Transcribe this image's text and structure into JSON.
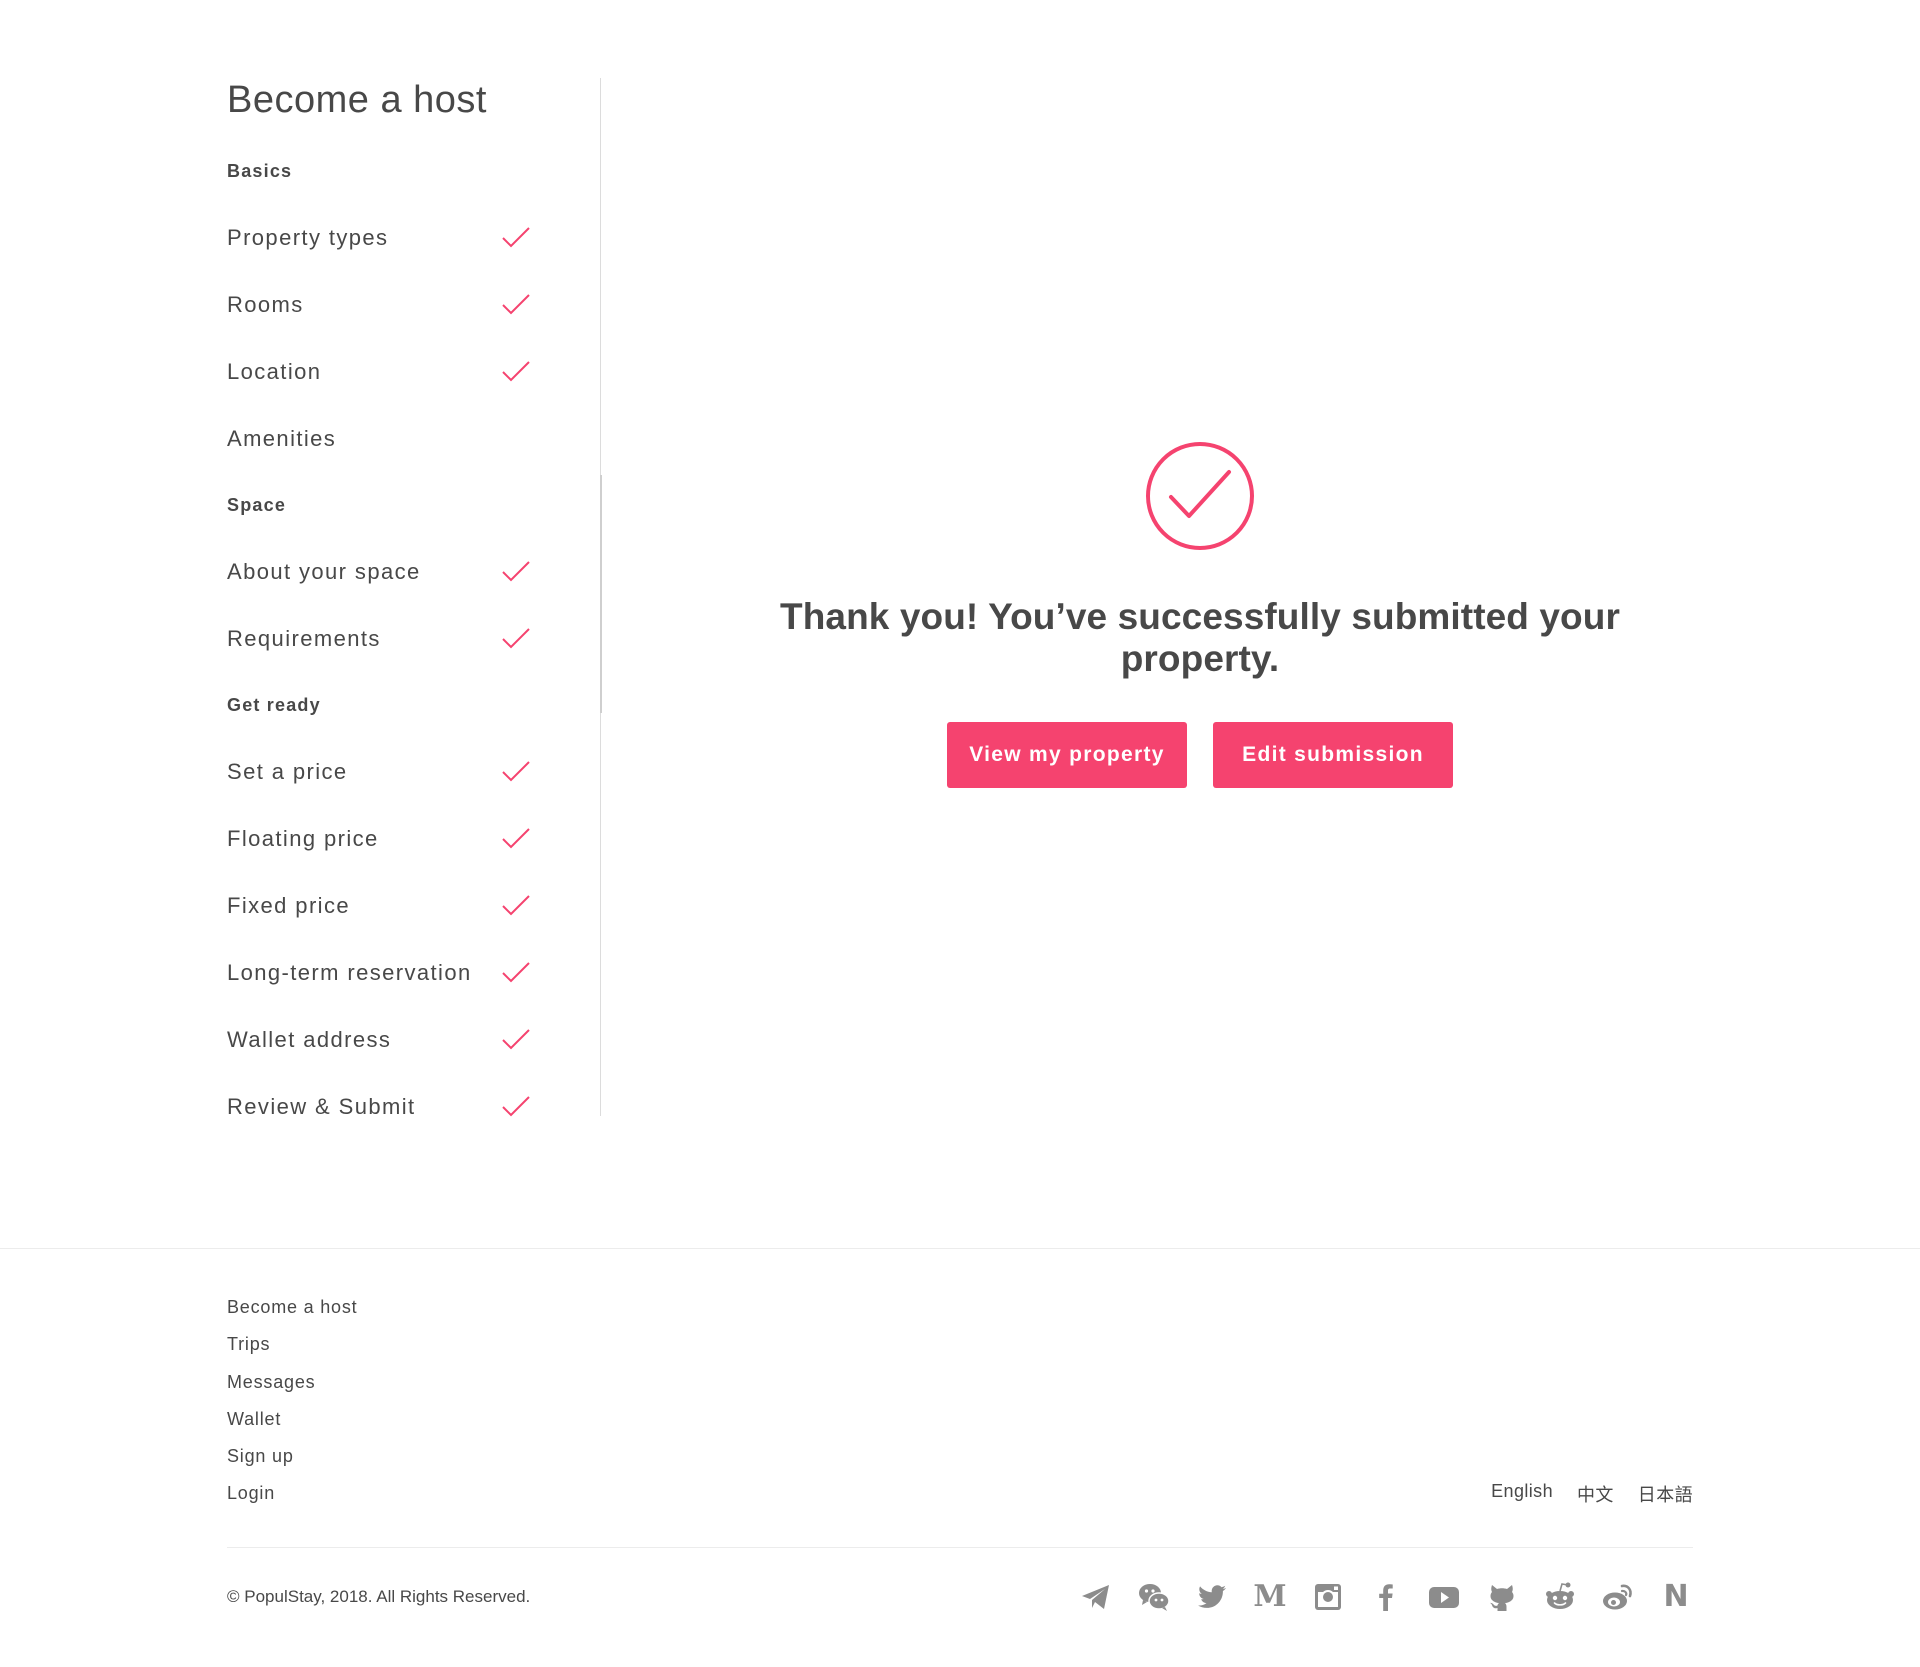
{
  "sidebar": {
    "title": "Become a host",
    "sections": [
      {
        "label": "Basics",
        "steps": [
          {
            "label": "Property types",
            "completed": true
          },
          {
            "label": "Rooms",
            "completed": true
          },
          {
            "label": "Location",
            "completed": true
          },
          {
            "label": "Amenities",
            "completed": false
          }
        ]
      },
      {
        "label": "Space",
        "steps": [
          {
            "label": "About your space",
            "completed": true
          },
          {
            "label": "Requirements",
            "completed": true
          }
        ]
      },
      {
        "label": "Get ready",
        "steps": [
          {
            "label": "Set a price",
            "completed": true
          },
          {
            "label": "Floating price",
            "completed": true
          },
          {
            "label": "Fixed price",
            "completed": true
          },
          {
            "label": "Long-term reservation",
            "completed": true
          },
          {
            "label": "Wallet address",
            "completed": true
          },
          {
            "label": "Review & Submit",
            "completed": true
          }
        ]
      }
    ]
  },
  "success": {
    "icon": "check-circle-icon",
    "message": "Thank you! You’ve successfully submitted your property.",
    "view_button_label": "View my property",
    "edit_button_label": "Edit submission"
  },
  "footer": {
    "links": [
      "Become a host",
      "Trips",
      "Messages",
      "Wallet",
      "Sign up",
      "Login"
    ],
    "languages": [
      "English",
      "中文",
      "日本語"
    ],
    "copyright": "© PopulStay, 2018. All Rights Reserved.",
    "social_icons": [
      "telegram-icon",
      "wechat-icon",
      "twitter-icon",
      "medium-icon",
      "instagram-icon",
      "facebook-icon",
      "youtube-icon",
      "github-icon",
      "reddit-icon",
      "weibo-icon",
      "notion-icon"
    ]
  },
  "colors": {
    "accent": "#f5436f",
    "text": "#484848",
    "icon_gray": "#8c8c8c",
    "divider": "#dcdcdc"
  }
}
